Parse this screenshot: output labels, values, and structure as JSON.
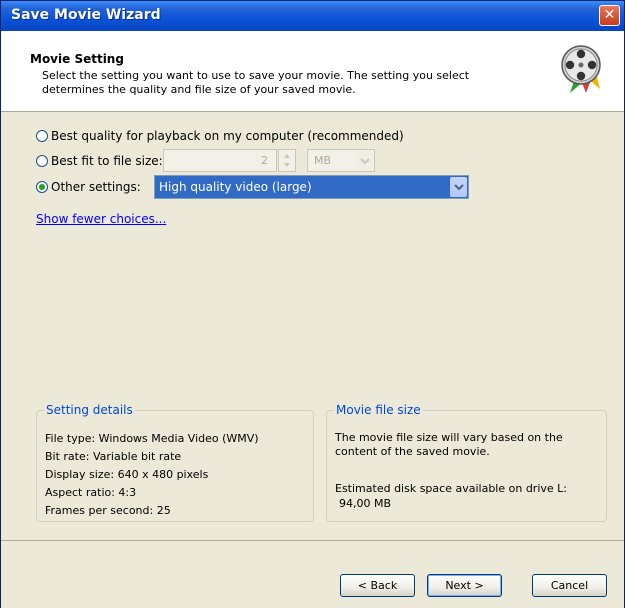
{
  "window": {
    "title": "Save Movie Wizard",
    "close_label": "✕"
  },
  "header": {
    "title": "Movie Setting",
    "description": "Select the setting you want to use to save your movie. The setting you select determines the quality and file size of your saved movie."
  },
  "options": {
    "best_quality_label": "Best quality for playback on my computer (recommended)",
    "best_fit_label": "Best fit to file size:",
    "file_size_value": "2",
    "file_size_unit": "MB",
    "other_settings_label": "Other settings:",
    "other_settings_value": "High quality video (large)",
    "selected": "other"
  },
  "show_fewer_link": "Show fewer choices...",
  "setting_details": {
    "legend": "Setting details",
    "lines": [
      "File type: Windows Media Video (WMV)",
      "Bit rate: Variable bit rate",
      "Display size: 640 x 480 pixels",
      "Aspect ratio: 4:3",
      "Frames per second: 25"
    ]
  },
  "movie_file_size": {
    "legend": "Movie file size",
    "note": "The movie file size will vary based on the content of the saved movie.",
    "disk_label": "Estimated disk space available on drive L:",
    "disk_value": "94,00 MB"
  },
  "buttons": {
    "back": "< Back",
    "next": "Next >",
    "cancel": "Cancel"
  },
  "colors": {
    "title_bar": "#0a53d8",
    "accent_link": "#0000ff",
    "selection": "#316ac5",
    "groupbox_legend": "#0046d5"
  }
}
